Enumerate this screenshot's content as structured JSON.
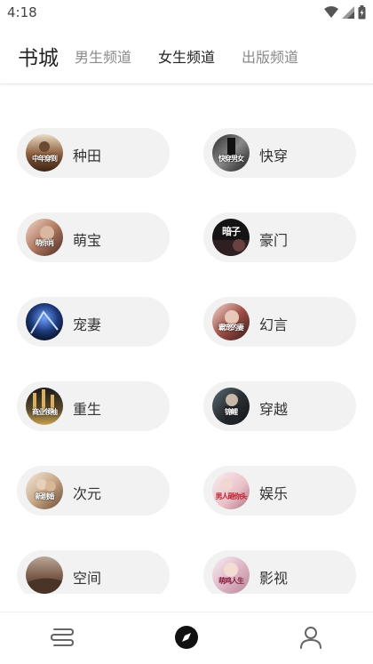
{
  "status_bar": {
    "time": "4:18",
    "icons": [
      "wifi-icon",
      "signal-icon",
      "battery-icon"
    ]
  },
  "header": {
    "title": "书城",
    "tabs": [
      {
        "label": "男生频道",
        "active": false
      },
      {
        "label": "女生频道",
        "active": true
      },
      {
        "label": "出版频道",
        "active": false
      }
    ]
  },
  "categories": [
    {
      "label": "种田",
      "cover_text": "中年穿到"
    },
    {
      "label": "快穿",
      "cover_text": "快穿男女"
    },
    {
      "label": "萌宝",
      "cover_text": "萌你肖"
    },
    {
      "label": "豪门",
      "cover_text": "暗子"
    },
    {
      "label": "宠妻",
      "cover_text": ""
    },
    {
      "label": "幻言",
      "cover_text": "霸宠的妻"
    },
    {
      "label": "重生",
      "cover_text": "商业领袖"
    },
    {
      "label": "穿越",
      "cover_text": "锦鲤"
    },
    {
      "label": "次元",
      "cover_text": "新剧婚"
    },
    {
      "label": "娱乐",
      "cover_text": "男人砸你头"
    },
    {
      "label": "空间",
      "cover_text": ""
    },
    {
      "label": "影视",
      "cover_text": "萌鸡人生"
    }
  ],
  "bottom_nav": [
    {
      "icon": "bookshelf-icon",
      "active": false
    },
    {
      "icon": "compass-icon",
      "active": true
    },
    {
      "icon": "profile-icon",
      "active": false
    }
  ],
  "colors": {
    "accent": "#111111",
    "tab_inactive": "#8a8a8a",
    "card_bg": "#f2f2f2"
  }
}
